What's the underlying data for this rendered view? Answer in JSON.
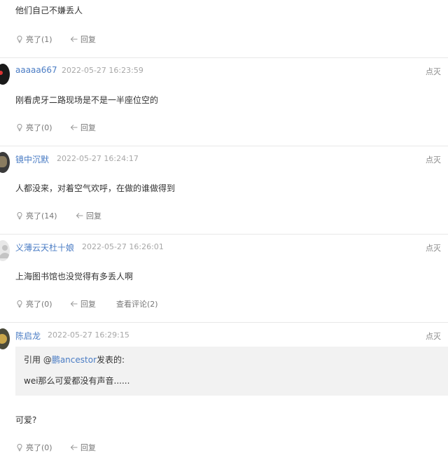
{
  "comments": [
    {
      "username": "",
      "time": "",
      "report": "",
      "text": "他们自己不嫌丢人",
      "like_label": "亮了(1)",
      "reply_label": "回复",
      "view_label": ""
    },
    {
      "username": "aaaaa667",
      "time": "2022-05-27 16:23:59",
      "report": "点灭",
      "text": "刚看虎牙二路现场是不是一半座位空的",
      "like_label": "亮了(0)",
      "reply_label": "回复",
      "view_label": ""
    },
    {
      "username": "镜中沉默",
      "time": "2022-05-27 16:24:17",
      "report": "点灭",
      "text": "人都没来，对着空气欢呼，在做的谁做得到",
      "like_label": "亮了(14)",
      "reply_label": "回复",
      "view_label": ""
    },
    {
      "username": "义薄云天杜十娘",
      "time": "2022-05-27 16:26:01",
      "report": "点灭",
      "text": "上海图书馆也没觉得有多丢人啊",
      "like_label": "亮了(0)",
      "reply_label": "回复",
      "view_label": "查看评论(2)"
    },
    {
      "username": "陈启龙",
      "time": "2022-05-27 16:29:15",
      "report": "点灭",
      "quote_prefix": "引用 @",
      "quote_user": "鹏ancestor",
      "quote_suffix": "发表的:",
      "quote_text": "wei那么可爱都没有声音......",
      "text": "可爱?",
      "like_label": "亮了(0)",
      "reply_label": "回复",
      "view_label": ""
    }
  ],
  "colors": {
    "username": "#4a7cc4",
    "time": "#a7a7a7",
    "separator": "#e8e8e8",
    "quote_bg": "#f2f2f2"
  }
}
